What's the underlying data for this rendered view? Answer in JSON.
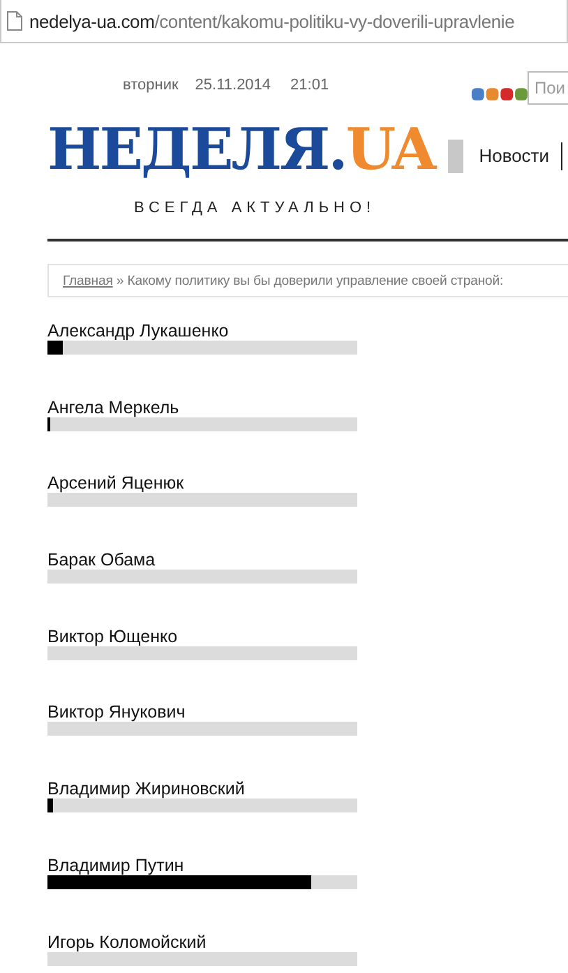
{
  "address_bar": {
    "host": "nedelya-ua.com",
    "path": "/content/kakomu-politiku-vy-doverili-upravlenie"
  },
  "header": {
    "weekday": "вторник",
    "date": "25.11.2014",
    "time": "21:01",
    "search": {
      "placeholder": "Пои"
    },
    "logo": {
      "main": "НЕДЕЛЯ.",
      "accent": "UA"
    },
    "nav": [
      "Новости"
    ],
    "slogan": "ВСЕГДА АКТУАЛЬНО!"
  },
  "breadcrumb": {
    "link": "Главная",
    "separator": "»",
    "current": "Какому политику вы бы доверили управление своей страной:"
  },
  "poll": [
    {
      "name": "Александр Лукашенко",
      "level": 0.05
    },
    {
      "name": "Ангела Меркель",
      "level": 0.01
    },
    {
      "name": "Арсений Яценюк"
    },
    {
      "name": "Барак Обама"
    },
    {
      "name": "Виктор Ющенко"
    },
    {
      "name": "Виктор Янукович"
    },
    {
      "name": "Владимир Жириновский",
      "level": 0.02
    },
    {
      "name": "Владимир Путин",
      "level": 0.85
    },
    {
      "name": "Игорь Коломойский"
    }
  ]
}
